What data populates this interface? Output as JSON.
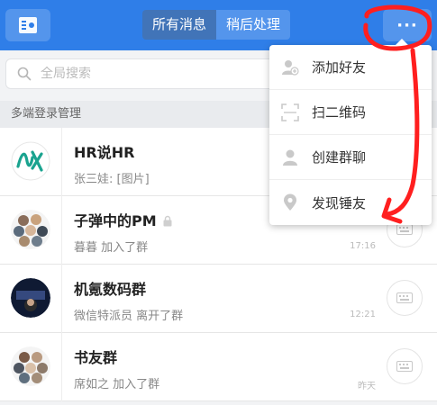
{
  "header": {
    "tabs": [
      {
        "label": "所有消息",
        "active": true
      },
      {
        "label": "稍后处理",
        "active": false
      }
    ],
    "more_label": "···",
    "accent": "#2f7ee8"
  },
  "search": {
    "placeholder": "全局搜索"
  },
  "section": {
    "label": "多端登录管理"
  },
  "conversations": [
    {
      "title": "HR说HR",
      "subtitle": "张三娃: [图片]",
      "time": "",
      "locked": false
    },
    {
      "title": "子弹中的PM",
      "subtitle": "暮暮 加入了群",
      "time": "17:16",
      "locked": true
    },
    {
      "title": "机氪数码群",
      "subtitle": "微信特派员 离开了群",
      "time": "12:21",
      "locked": false
    },
    {
      "title": "书友群",
      "subtitle": "席如之 加入了群",
      "time": "昨天",
      "locked": false
    }
  ],
  "menu": {
    "items": [
      {
        "label": "添加好友",
        "icon": "add-friend-icon"
      },
      {
        "label": "扫二维码",
        "icon": "scan-icon"
      },
      {
        "label": "创建群聊",
        "icon": "person-icon"
      },
      {
        "label": "发现锤友",
        "icon": "location-pin-icon"
      }
    ]
  },
  "annotation_color": "#ff1f1f"
}
